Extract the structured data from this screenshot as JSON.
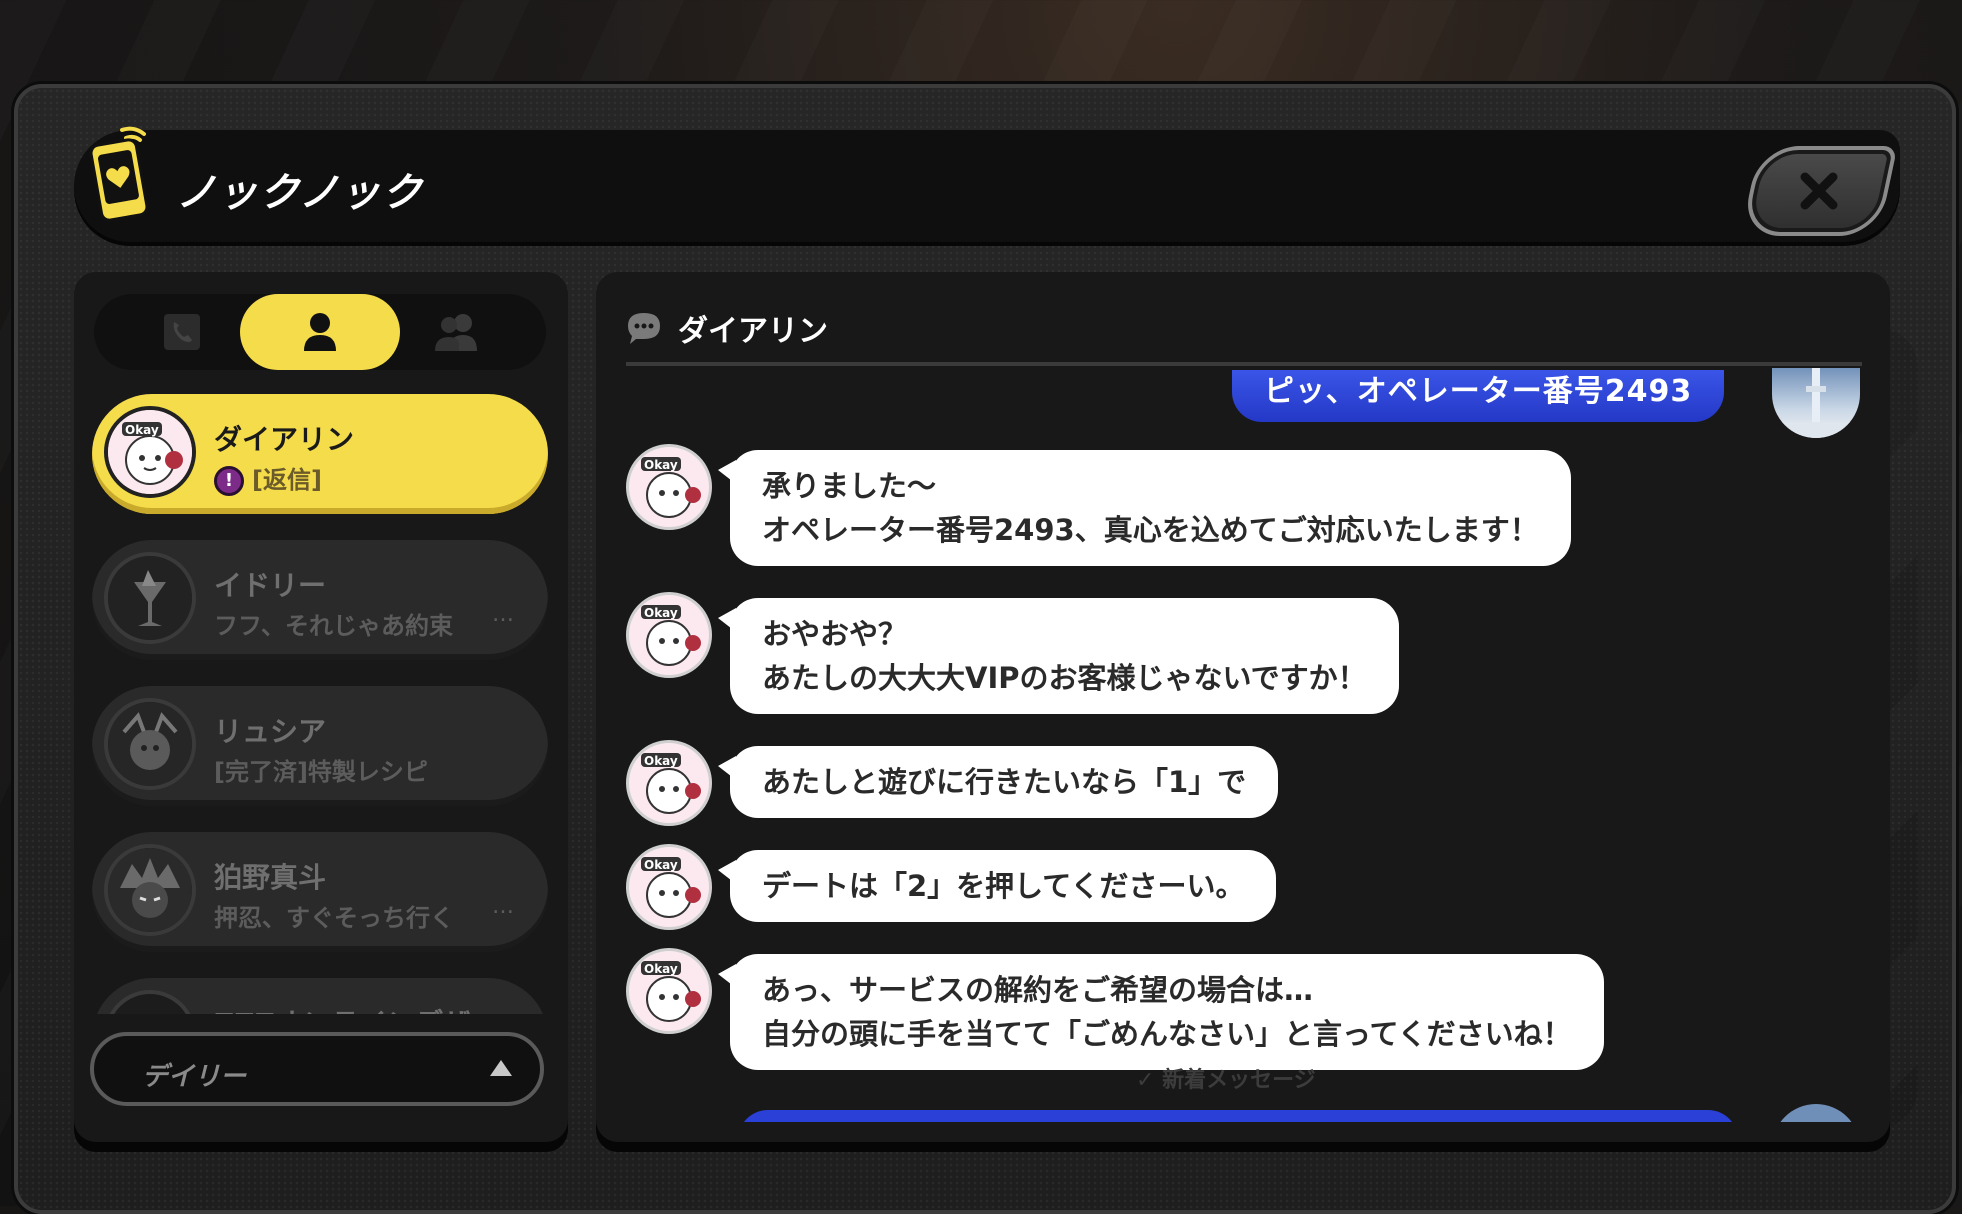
{
  "app": {
    "title": "ノックノック",
    "close_icon": "close-icon",
    "app_icon": "phone-heart-icon"
  },
  "colors": {
    "accent_yellow": "#f5dc4a",
    "outgoing_blue": "#2f47dc",
    "reply_badge_purple": "#7d2b88"
  },
  "sidebar": {
    "tabs": [
      {
        "icon": "phone-icon",
        "active": false
      },
      {
        "icon": "person-icon",
        "active": true
      },
      {
        "icon": "group-icon",
        "active": false
      }
    ],
    "contacts": [
      {
        "name": "ダイアリン",
        "preview": "[返信]",
        "badge": "!",
        "active": true,
        "avatar": "okay-girl-avatar"
      },
      {
        "name": "イドリー",
        "preview": "フフ、それじゃあ約束",
        "ellipsis": "…",
        "active": false,
        "avatar": "glass-avatar"
      },
      {
        "name": "リュシア",
        "preview": "[完了済]特製レシピ",
        "active": false,
        "avatar": "lucia-avatar"
      },
      {
        "name": "狛野真斗",
        "preview": "押忍、すぐそっち行く",
        "ellipsis": "…",
        "active": false,
        "avatar": "komano-avatar"
      },
      {
        "name": "ZZZオンラインデザ",
        "preview": "",
        "ellipsis": "…",
        "active": false,
        "avatar": "zzz-avatar"
      }
    ],
    "filter": {
      "label": "デイリー",
      "arrow_icon": "triangle-up-icon"
    }
  },
  "chat": {
    "header_icon": "speech-bubble-icon",
    "contact_name": "ダイアリン",
    "outgoing_top": "ピッ、オペレーター番号2493",
    "messages": [
      {
        "line1": "承りました～",
        "line2": "オペレーター番号2493、真心を込めてご対応いたします！"
      },
      {
        "line1": "おやおや？",
        "line2": "あたしの大大大VIPのお客様じゃないですか！"
      },
      {
        "line1": "あたしと遊びに行きたいなら「1」で",
        "line2": ""
      },
      {
        "line1": "デートは「2」を押してくださーい。",
        "line2": ""
      },
      {
        "line1": "あっ、サービスの解約をご希望の場合は…",
        "line2": "自分の頭に手を当てて「ごめんなさい」と言ってくださいね！"
      }
    ],
    "new_messages_label": "✓ 新着メッセージ"
  }
}
